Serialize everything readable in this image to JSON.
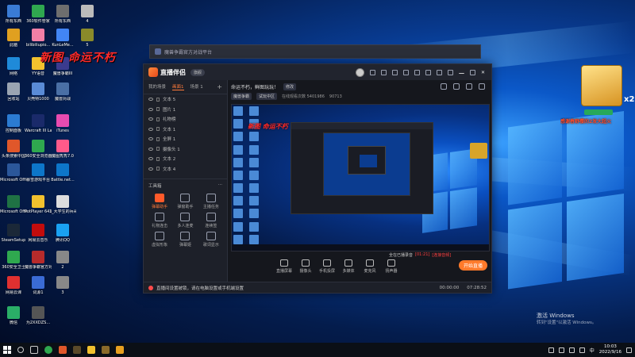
{
  "desktop": {
    "overlay_text": "新图 命运不朽",
    "icons": [
      {
        "label": "所有东西",
        "color": "#3a7bd5"
      },
      {
        "label": "360软件管家",
        "color": "#2fa84f"
      },
      {
        "label": "所有东西",
        "color": "#6e6e6e"
      },
      {
        "label": "4",
        "color": "#bbbbbb"
      },
      {
        "label": "此脑",
        "color": "#e0a020"
      },
      {
        "label": "bilibiliupio...",
        "color": "#f27fa6"
      },
      {
        "label": "KunLeMe...",
        "color": "#4285f4"
      },
      {
        "label": "5",
        "color": "#8a8a2a"
      },
      {
        "label": "网络",
        "color": "#1f8ad9"
      },
      {
        "label": "YY语音",
        "color": "#f2c12e"
      },
      {
        "label": "回收站",
        "color": "#9aa4b2"
      },
      {
        "label": "贝壳特1000",
        "color": "#5a8bd6"
      },
      {
        "label": "魔兽争霸III",
        "color": "#3b3b8f"
      },
      {
        "label": "控制面板",
        "color": "#2b7bd2"
      },
      {
        "label": "Warcraft III Launcher",
        "color": "#1a2a6a"
      },
      {
        "label": "魔兽对战",
        "color": "#4a6fa5"
      },
      {
        "label": "头条搜索中国",
        "color": "#e0572a"
      },
      {
        "label": "360安全浏览器",
        "color": "#2fa84f"
      },
      {
        "label": "iTunes",
        "color": "#e84bb0"
      },
      {
        "label": "Microsoft Office Wo...",
        "color": "#2b579a"
      },
      {
        "label": "暴雪游戏平台",
        "color": "#0d76c9"
      },
      {
        "label": "魔图秀秀7.0",
        "color": "#ff5a8a"
      },
      {
        "label": "Microsoft Office Exc...",
        "color": "#1f7244"
      },
      {
        "label": "PotPlayer 64 bit",
        "color": "#f2c12e"
      },
      {
        "label": "Battle.net...",
        "color": "#0d76c9"
      },
      {
        "label": "SteamSetup",
        "color": "#1b2838"
      },
      {
        "label": "网易云音乐",
        "color": "#c20c0c"
      },
      {
        "label": "1_大学生的兵哥没道德团",
        "color": "#dddddd"
      },
      {
        "label": "360安全卫士",
        "color": "#2fa84f"
      },
      {
        "label": "魔兽争霸官方对战平台",
        "color": "#b72b2b"
      },
      {
        "label": "腾讯QQ",
        "color": "#1aa1f2"
      },
      {
        "label": "网易云课",
        "color": "#e03030"
      },
      {
        "label": "词源1",
        "color": "#3a6bd5"
      },
      {
        "label": "2",
        "color": "#888888"
      },
      {
        "label": "微信",
        "color": "#2aae67"
      },
      {
        "label": "为2XXDZS...",
        "color": "#555555"
      },
      {
        "label": "3",
        "color": "#888888"
      }
    ],
    "thumb_banner": "感谢春野樱的2发大超火",
    "thumb_count": "x2",
    "activate_line1": "激活 Windows",
    "activate_line2": "转到\"设置\"以激活 Windows。"
  },
  "back_window": {
    "title": "魔兽争霸官方对战平台"
  },
  "app": {
    "logo_text": "直播伴侣",
    "version_pill": "旗舰",
    "left_tabs": [
      "我的场景",
      "画面1",
      "场景 1"
    ],
    "active_tab_index": 1,
    "add_scene": "+",
    "layers": [
      "文本 5",
      "图片 1",
      "礼物榜",
      "文本 1",
      "全屏 1",
      "摄像头 1",
      "文本 2",
      "文本 4"
    ],
    "toolbox_title": "工具箱",
    "toolbox_more": "···",
    "tools": [
      {
        "label": "弹幕助手",
        "active": true
      },
      {
        "label": "弹窗助手",
        "active": false
      },
      {
        "label": "主播任务",
        "active": false
      },
      {
        "label": "礼物连击",
        "active": false
      },
      {
        "label": "多人连麦",
        "active": false
      },
      {
        "label": "连续签",
        "active": false
      },
      {
        "label": "虚拟形象",
        "active": false
      },
      {
        "label": "弹幕姬",
        "active": false
      },
      {
        "label": "歌词显示",
        "active": false
      }
    ],
    "stream_title": "命运不朽，鲜图玩玩！",
    "edit_button": "修改",
    "tag1": "魔兽争霸",
    "tag2": "试玩中区",
    "meta1": "在线观看次数 5401986",
    "meta2": "90713",
    "preview_overlay": "新图 命运不朽",
    "controls": [
      "直播屏幕",
      "摄像头",
      "手机投屏",
      "多媒体",
      "麦克风",
      "扬声器"
    ],
    "live_text": "全在已播录音",
    "live_highlight": "[01:21]",
    "live_status": "[连接音频]",
    "start_live": "开始直播",
    "status_warning": "直播间设置被锁，请在电脑设置或手机端设置",
    "time_left": "00:00:00",
    "time_right": "07:28:52"
  },
  "taskbar": {
    "time": "10:03",
    "date": "2022/9/16",
    "lang": "中"
  }
}
